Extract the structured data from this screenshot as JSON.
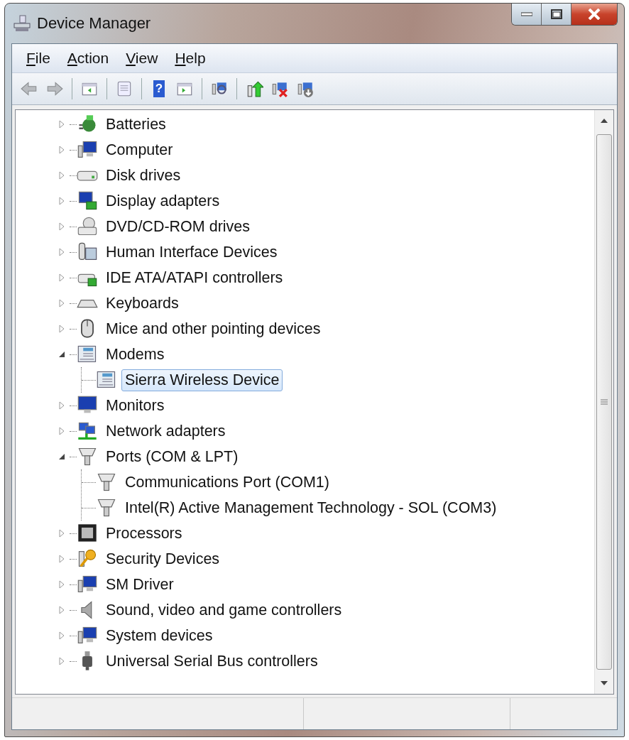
{
  "window": {
    "title": "Device Manager"
  },
  "menu": [
    {
      "label": "File"
    },
    {
      "label": "Action"
    },
    {
      "label": "View"
    },
    {
      "label": "Help"
    }
  ],
  "toolbar": {
    "help_glyph": "?"
  },
  "tree": {
    "items": [
      {
        "label": "Batteries",
        "expanded": false,
        "selected": false
      },
      {
        "label": "Computer",
        "expanded": false,
        "selected": false
      },
      {
        "label": "Disk drives",
        "expanded": false,
        "selected": false
      },
      {
        "label": "Display adapters",
        "expanded": false,
        "selected": false
      },
      {
        "label": "DVD/CD-ROM drives",
        "expanded": false,
        "selected": false
      },
      {
        "label": "Human Interface Devices",
        "expanded": false,
        "selected": false
      },
      {
        "label": "IDE ATA/ATAPI controllers",
        "expanded": false,
        "selected": false
      },
      {
        "label": "Keyboards",
        "expanded": false,
        "selected": false
      },
      {
        "label": "Mice and other pointing devices",
        "expanded": false,
        "selected": false
      },
      {
        "label": "Modems",
        "expanded": true,
        "selected": false,
        "children": [
          {
            "label": "Sierra Wireless Device",
            "selected": true
          }
        ]
      },
      {
        "label": "Monitors",
        "expanded": false,
        "selected": false
      },
      {
        "label": "Network adapters",
        "expanded": false,
        "selected": false
      },
      {
        "label": "Ports (COM & LPT)",
        "expanded": true,
        "selected": false,
        "children": [
          {
            "label": "Communications Port (COM1)",
            "selected": false
          },
          {
            "label": "Intel(R) Active Management Technology - SOL (COM3)",
            "selected": false
          }
        ]
      },
      {
        "label": "Processors",
        "expanded": false,
        "selected": false
      },
      {
        "label": "Security Devices",
        "expanded": false,
        "selected": false
      },
      {
        "label": "SM Driver",
        "expanded": false,
        "selected": false
      },
      {
        "label": "Sound, video and game controllers",
        "expanded": false,
        "selected": false
      },
      {
        "label": "System devices",
        "expanded": false,
        "selected": false
      },
      {
        "label": "Universal Serial Bus controllers",
        "expanded": false,
        "selected": false
      }
    ]
  }
}
